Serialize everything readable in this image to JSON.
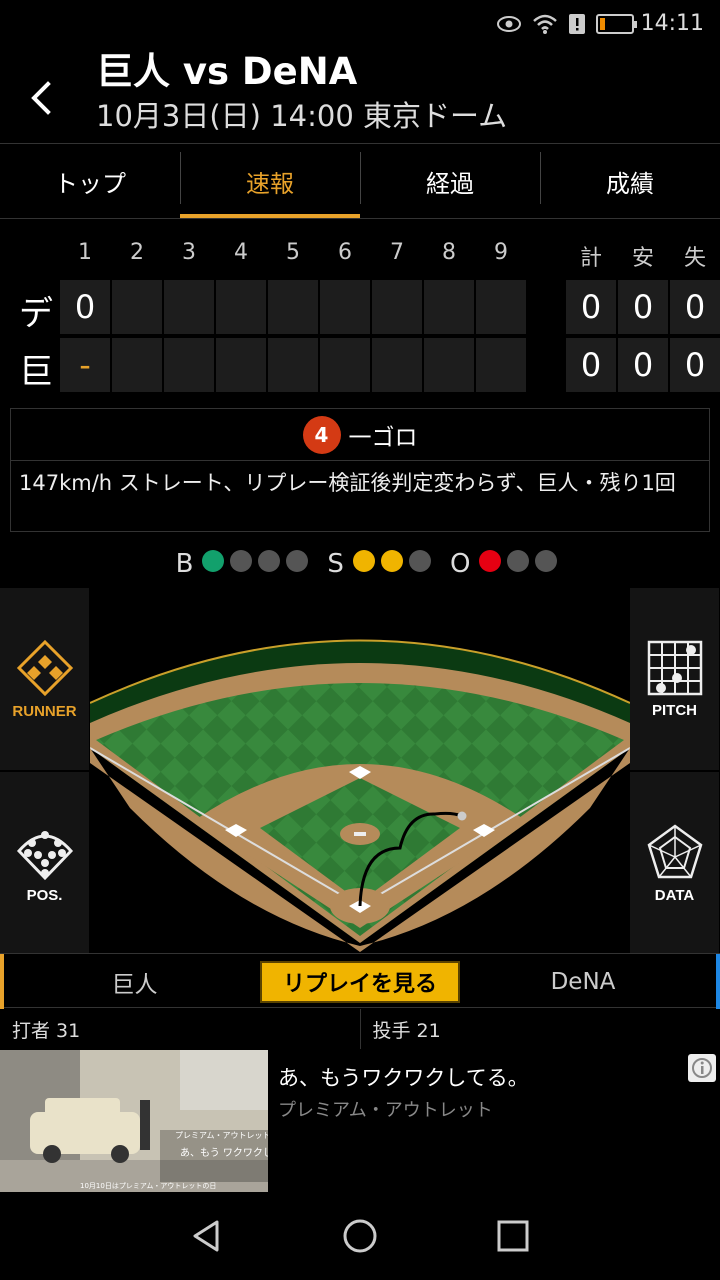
{
  "status": {
    "time": "14:11",
    "battery_level": 0.15
  },
  "header": {
    "title": "巨人 vs DeNA",
    "subtitle": "10月3日(日) 14:00 東京ドーム"
  },
  "tabs": [
    {
      "label": "トップ",
      "active": false
    },
    {
      "label": "速報",
      "active": true
    },
    {
      "label": "経過",
      "active": false
    },
    {
      "label": "成績",
      "active": false
    }
  ],
  "scoreboard": {
    "innings": [
      "1",
      "2",
      "3",
      "4",
      "5",
      "6",
      "7",
      "8",
      "9"
    ],
    "totals_headers": [
      "計",
      "安",
      "失"
    ],
    "rows": [
      {
        "team": "デ",
        "innings": [
          "0",
          "",
          "",
          "",
          "",
          "",
          "",
          "",
          ""
        ],
        "totals": [
          "0",
          "0",
          "0"
        ]
      },
      {
        "team": "巨",
        "innings": [
          "-",
          "",
          "",
          "",
          "",
          "",
          "",
          "",
          ""
        ],
        "totals": [
          "0",
          "0",
          "0"
        ]
      }
    ]
  },
  "play": {
    "number": "4",
    "result": "一ゴロ",
    "description": "147km/h ストレート、リプレー検証後判定変わらず、巨人・残り1回"
  },
  "count": {
    "b_label": "B",
    "balls": 1,
    "balls_max": 4,
    "s_label": "S",
    "strikes": 2,
    "strikes_max": 3,
    "o_label": "O",
    "outs": 1,
    "outs_max": 3
  },
  "side_buttons": {
    "runner": "RUNNER",
    "pos": "POS.",
    "pitch": "PITCH",
    "data": "DATA"
  },
  "team_bar": {
    "home": "巨人",
    "replay": "リプレイを見る",
    "away": "DeNA"
  },
  "players": {
    "batter": "打者  31",
    "pitcher": "投手  21"
  },
  "ad": {
    "title": "あ、もうワクワクしてる。",
    "subtitle": "プレミアム・アウトレット",
    "image_caption": "プレミアム・アウトレット",
    "image_text": "あ、もう ワクワクしてる",
    "image_footer": "10月10日はプレミアム・アウトレットの日"
  },
  "colors": {
    "accent": "#e8a22a",
    "ball": "#12a06c",
    "strike": "#f0b400",
    "out": "#e60012",
    "away_team": "#1e88e5"
  }
}
